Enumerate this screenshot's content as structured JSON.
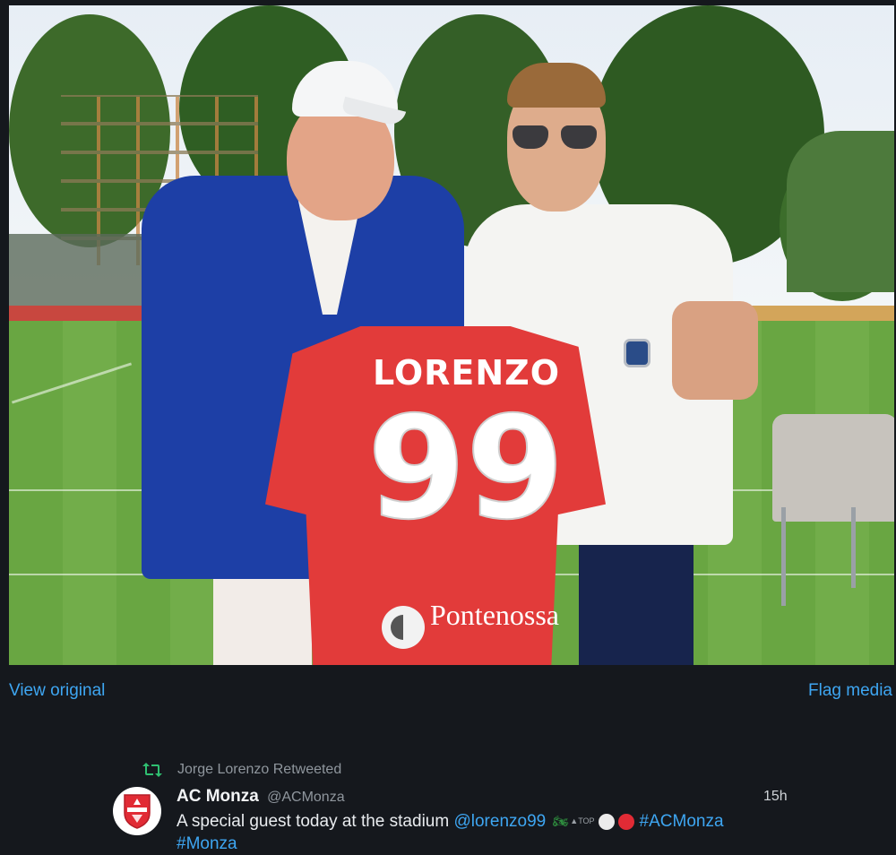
{
  "photo": {
    "jersey_name": "LORENZO",
    "jersey_number": "99",
    "sponsor": "Pontenossa",
    "alt_icon": "photo-two-men-holding-red-jersey"
  },
  "media_actions": {
    "view_original": "View original",
    "flag_media": "Flag media"
  },
  "tweet": {
    "retweeted_by": "Jorge Lorenzo Retweeted",
    "author": "AC Monza",
    "handle": "@ACMonza",
    "time": "15h",
    "text_prefix": "A special guest today at the stadium ",
    "mention": "@lorenzo99",
    "emoji_top_label": "TOP",
    "hashtags": [
      "#ACMonza",
      "#Monza"
    ],
    "avatar_icon": "ac-monza-crest-icon"
  },
  "colors": {
    "background": "#15181d",
    "link": "#3ea6f2",
    "retweet_green": "#2fbf71",
    "jersey_red": "#e23b3a"
  }
}
